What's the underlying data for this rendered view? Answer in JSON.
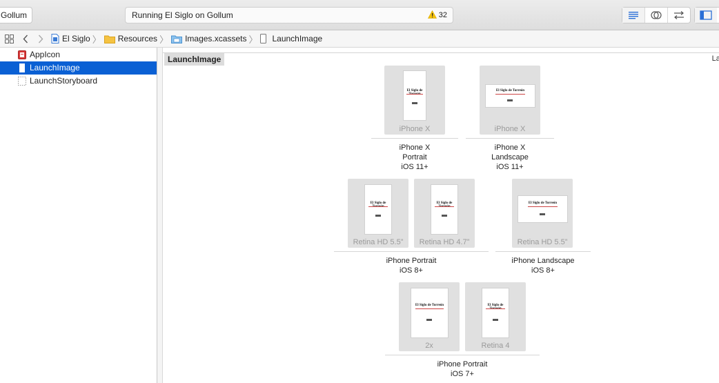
{
  "toolbar": {
    "scheme_label": "Gollum",
    "activity_status": "Running El Siglo on Gollum",
    "warning_count": "32"
  },
  "jumpbar": {
    "crumbs": [
      "El Siglo",
      "Resources",
      "Images.xcassets",
      "LaunchImage"
    ]
  },
  "sidebar": {
    "items": [
      {
        "label": "AppIcon",
        "icon": "appicon-icon",
        "selected": false
      },
      {
        "label": "LaunchImage",
        "icon": "launchimage-icon",
        "selected": true
      },
      {
        "label": "LaunchStoryboard",
        "icon": "storyboard-icon",
        "selected": false
      }
    ]
  },
  "editor": {
    "set_name": "LaunchImage",
    "right_label": "Lau",
    "groups": [
      {
        "slots": [
          {
            "caption": "iPhone X",
            "orientation": "portrait"
          }
        ],
        "label": [
          "iPhone X",
          "Portrait",
          "iOS 11+"
        ]
      },
      {
        "slots": [
          {
            "caption": "iPhone X",
            "orientation": "landscape"
          }
        ],
        "label": [
          "iPhone X",
          "Landscape",
          "iOS 11+"
        ]
      },
      {
        "slots": [
          {
            "caption": "Retina HD 5.5”",
            "orientation": "portrait"
          },
          {
            "caption": "Retina HD 4.7”",
            "orientation": "portrait"
          }
        ],
        "label": [
          "iPhone Portrait",
          "iOS 8+"
        ]
      },
      {
        "slots": [
          {
            "caption": "Retina HD 5.5”",
            "orientation": "landscape"
          }
        ],
        "label": [
          "iPhone Landscape",
          "iOS 8+"
        ]
      },
      {
        "slots": [
          {
            "caption": "2x",
            "orientation": "portrait"
          },
          {
            "caption": "Retina 4",
            "orientation": "portrait"
          }
        ],
        "label": [
          "iPhone Portrait",
          "iOS 7+"
        ]
      }
    ],
    "thumbnail_title": "El Siglo de Torreón"
  },
  "colors": {
    "selection": "#0a60d4",
    "folder": "#f5c342",
    "warning": "#f4c20d"
  }
}
